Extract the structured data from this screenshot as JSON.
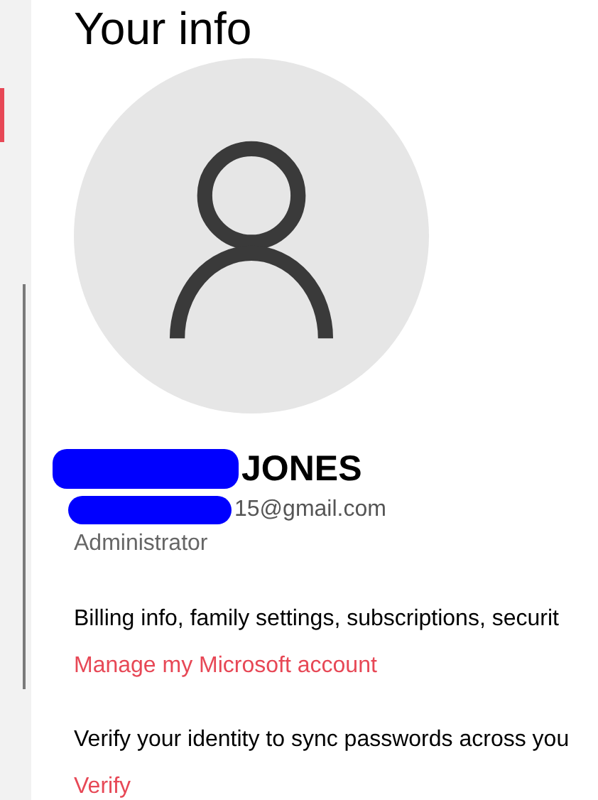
{
  "sidebar": {
    "items": [
      {
        "selected": true
      }
    ]
  },
  "title": "Your info",
  "account": {
    "name": "JONES",
    "email": "15@gmail.com",
    "role": "Administrator",
    "redacted": true
  },
  "sections": [
    {
      "text": "Billing info, family settings, subscriptions, securit",
      "link": "Manage my Microsoft account"
    },
    {
      "text": "Verify your identity to sync passwords across you",
      "link": "Verify"
    }
  ]
}
